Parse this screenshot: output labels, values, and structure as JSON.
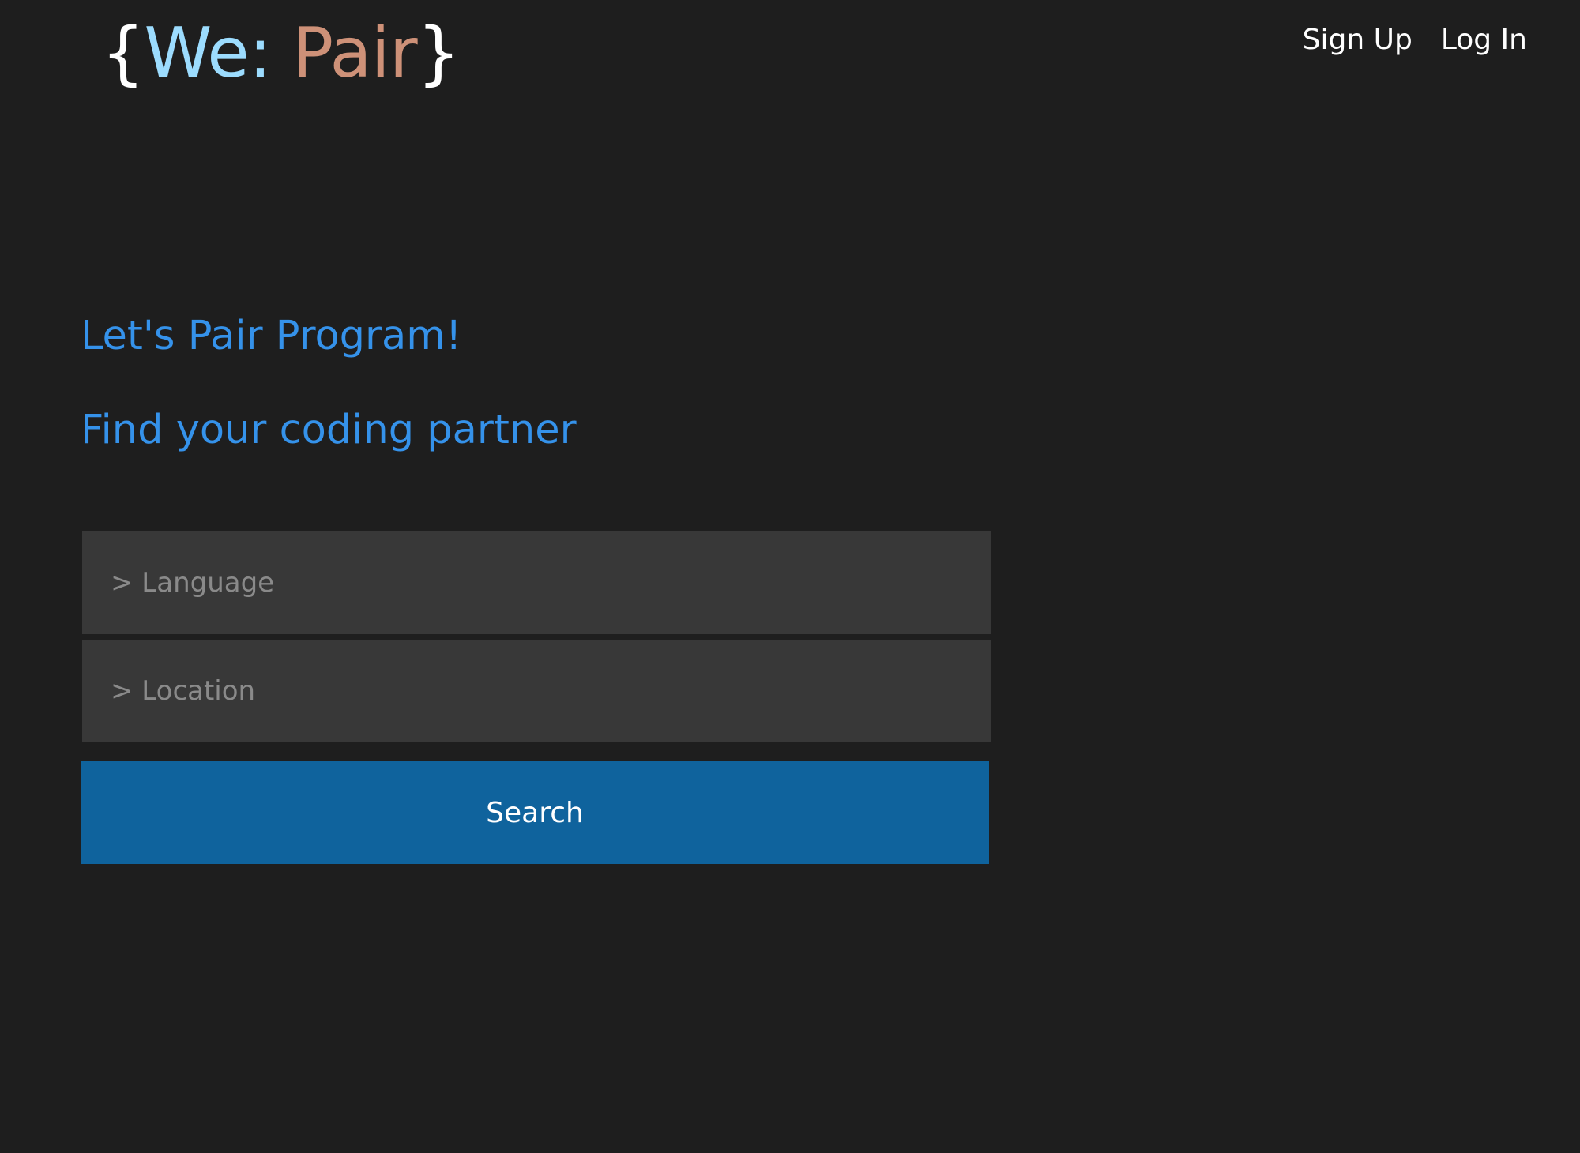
{
  "logo": {
    "open_brace": "{",
    "we": "We:",
    "pair": "Pair",
    "close_brace": "}"
  },
  "nav": {
    "sign_up": "Sign Up",
    "log_in": "Log In"
  },
  "hero": {
    "title": "Let's Pair Program!",
    "subtitle": "Find your coding partner"
  },
  "form": {
    "language_placeholder": "> Language",
    "location_placeholder": "> Location",
    "search_label": "Search"
  },
  "colors": {
    "background": "#1e1e1e",
    "logo_we": "#9cdcfe",
    "logo_pair": "#ce9178",
    "headline": "#3592ea",
    "input_background": "#383838",
    "button": "#0f639d"
  }
}
